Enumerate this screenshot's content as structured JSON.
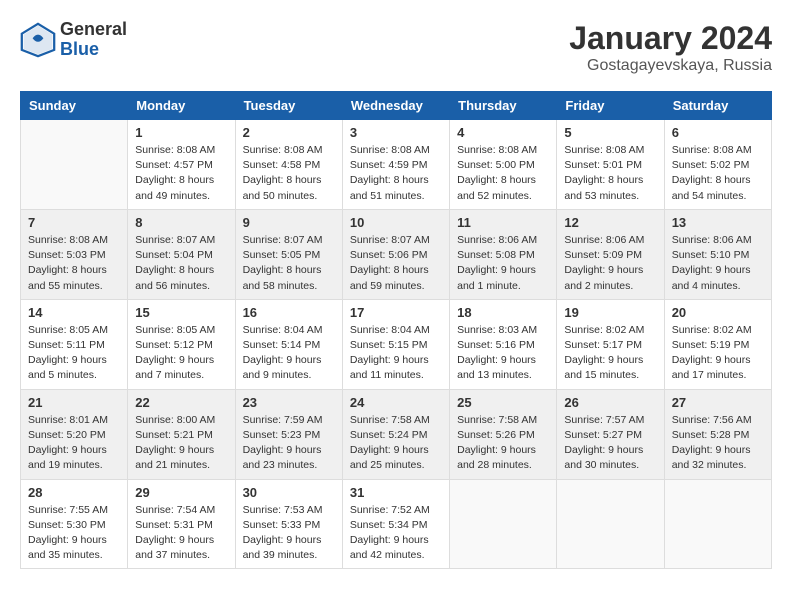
{
  "logo": {
    "general": "General",
    "blue": "Blue"
  },
  "title": "January 2024",
  "subtitle": "Gostagayevskaya, Russia",
  "days_of_week": [
    "Sunday",
    "Monday",
    "Tuesday",
    "Wednesday",
    "Thursday",
    "Friday",
    "Saturday"
  ],
  "weeks": [
    [
      {
        "num": "",
        "sunrise": "",
        "sunset": "",
        "daylight": "",
        "empty": true
      },
      {
        "num": "1",
        "sunrise": "Sunrise: 8:08 AM",
        "sunset": "Sunset: 4:57 PM",
        "daylight": "Daylight: 8 hours and 49 minutes."
      },
      {
        "num": "2",
        "sunrise": "Sunrise: 8:08 AM",
        "sunset": "Sunset: 4:58 PM",
        "daylight": "Daylight: 8 hours and 50 minutes."
      },
      {
        "num": "3",
        "sunrise": "Sunrise: 8:08 AM",
        "sunset": "Sunset: 4:59 PM",
        "daylight": "Daylight: 8 hours and 51 minutes."
      },
      {
        "num": "4",
        "sunrise": "Sunrise: 8:08 AM",
        "sunset": "Sunset: 5:00 PM",
        "daylight": "Daylight: 8 hours and 52 minutes."
      },
      {
        "num": "5",
        "sunrise": "Sunrise: 8:08 AM",
        "sunset": "Sunset: 5:01 PM",
        "daylight": "Daylight: 8 hours and 53 minutes."
      },
      {
        "num": "6",
        "sunrise": "Sunrise: 8:08 AM",
        "sunset": "Sunset: 5:02 PM",
        "daylight": "Daylight: 8 hours and 54 minutes."
      }
    ],
    [
      {
        "num": "7",
        "sunrise": "Sunrise: 8:08 AM",
        "sunset": "Sunset: 5:03 PM",
        "daylight": "Daylight: 8 hours and 55 minutes."
      },
      {
        "num": "8",
        "sunrise": "Sunrise: 8:07 AM",
        "sunset": "Sunset: 5:04 PM",
        "daylight": "Daylight: 8 hours and 56 minutes."
      },
      {
        "num": "9",
        "sunrise": "Sunrise: 8:07 AM",
        "sunset": "Sunset: 5:05 PM",
        "daylight": "Daylight: 8 hours and 58 minutes."
      },
      {
        "num": "10",
        "sunrise": "Sunrise: 8:07 AM",
        "sunset": "Sunset: 5:06 PM",
        "daylight": "Daylight: 8 hours and 59 minutes."
      },
      {
        "num": "11",
        "sunrise": "Sunrise: 8:06 AM",
        "sunset": "Sunset: 5:08 PM",
        "daylight": "Daylight: 9 hours and 1 minute."
      },
      {
        "num": "12",
        "sunrise": "Sunrise: 8:06 AM",
        "sunset": "Sunset: 5:09 PM",
        "daylight": "Daylight: 9 hours and 2 minutes."
      },
      {
        "num": "13",
        "sunrise": "Sunrise: 8:06 AM",
        "sunset": "Sunset: 5:10 PM",
        "daylight": "Daylight: 9 hours and 4 minutes."
      }
    ],
    [
      {
        "num": "14",
        "sunrise": "Sunrise: 8:05 AM",
        "sunset": "Sunset: 5:11 PM",
        "daylight": "Daylight: 9 hours and 5 minutes."
      },
      {
        "num": "15",
        "sunrise": "Sunrise: 8:05 AM",
        "sunset": "Sunset: 5:12 PM",
        "daylight": "Daylight: 9 hours and 7 minutes."
      },
      {
        "num": "16",
        "sunrise": "Sunrise: 8:04 AM",
        "sunset": "Sunset: 5:14 PM",
        "daylight": "Daylight: 9 hours and 9 minutes."
      },
      {
        "num": "17",
        "sunrise": "Sunrise: 8:04 AM",
        "sunset": "Sunset: 5:15 PM",
        "daylight": "Daylight: 9 hours and 11 minutes."
      },
      {
        "num": "18",
        "sunrise": "Sunrise: 8:03 AM",
        "sunset": "Sunset: 5:16 PM",
        "daylight": "Daylight: 9 hours and 13 minutes."
      },
      {
        "num": "19",
        "sunrise": "Sunrise: 8:02 AM",
        "sunset": "Sunset: 5:17 PM",
        "daylight": "Daylight: 9 hours and 15 minutes."
      },
      {
        "num": "20",
        "sunrise": "Sunrise: 8:02 AM",
        "sunset": "Sunset: 5:19 PM",
        "daylight": "Daylight: 9 hours and 17 minutes."
      }
    ],
    [
      {
        "num": "21",
        "sunrise": "Sunrise: 8:01 AM",
        "sunset": "Sunset: 5:20 PM",
        "daylight": "Daylight: 9 hours and 19 minutes."
      },
      {
        "num": "22",
        "sunrise": "Sunrise: 8:00 AM",
        "sunset": "Sunset: 5:21 PM",
        "daylight": "Daylight: 9 hours and 21 minutes."
      },
      {
        "num": "23",
        "sunrise": "Sunrise: 7:59 AM",
        "sunset": "Sunset: 5:23 PM",
        "daylight": "Daylight: 9 hours and 23 minutes."
      },
      {
        "num": "24",
        "sunrise": "Sunrise: 7:58 AM",
        "sunset": "Sunset: 5:24 PM",
        "daylight": "Daylight: 9 hours and 25 minutes."
      },
      {
        "num": "25",
        "sunrise": "Sunrise: 7:58 AM",
        "sunset": "Sunset: 5:26 PM",
        "daylight": "Daylight: 9 hours and 28 minutes."
      },
      {
        "num": "26",
        "sunrise": "Sunrise: 7:57 AM",
        "sunset": "Sunset: 5:27 PM",
        "daylight": "Daylight: 9 hours and 30 minutes."
      },
      {
        "num": "27",
        "sunrise": "Sunrise: 7:56 AM",
        "sunset": "Sunset: 5:28 PM",
        "daylight": "Daylight: 9 hours and 32 minutes."
      }
    ],
    [
      {
        "num": "28",
        "sunrise": "Sunrise: 7:55 AM",
        "sunset": "Sunset: 5:30 PM",
        "daylight": "Daylight: 9 hours and 35 minutes."
      },
      {
        "num": "29",
        "sunrise": "Sunrise: 7:54 AM",
        "sunset": "Sunset: 5:31 PM",
        "daylight": "Daylight: 9 hours and 37 minutes."
      },
      {
        "num": "30",
        "sunrise": "Sunrise: 7:53 AM",
        "sunset": "Sunset: 5:33 PM",
        "daylight": "Daylight: 9 hours and 39 minutes."
      },
      {
        "num": "31",
        "sunrise": "Sunrise: 7:52 AM",
        "sunset": "Sunset: 5:34 PM",
        "daylight": "Daylight: 9 hours and 42 minutes."
      },
      {
        "num": "",
        "sunrise": "",
        "sunset": "",
        "daylight": "",
        "empty": true
      },
      {
        "num": "",
        "sunrise": "",
        "sunset": "",
        "daylight": "",
        "empty": true
      },
      {
        "num": "",
        "sunrise": "",
        "sunset": "",
        "daylight": "",
        "empty": true
      }
    ]
  ]
}
